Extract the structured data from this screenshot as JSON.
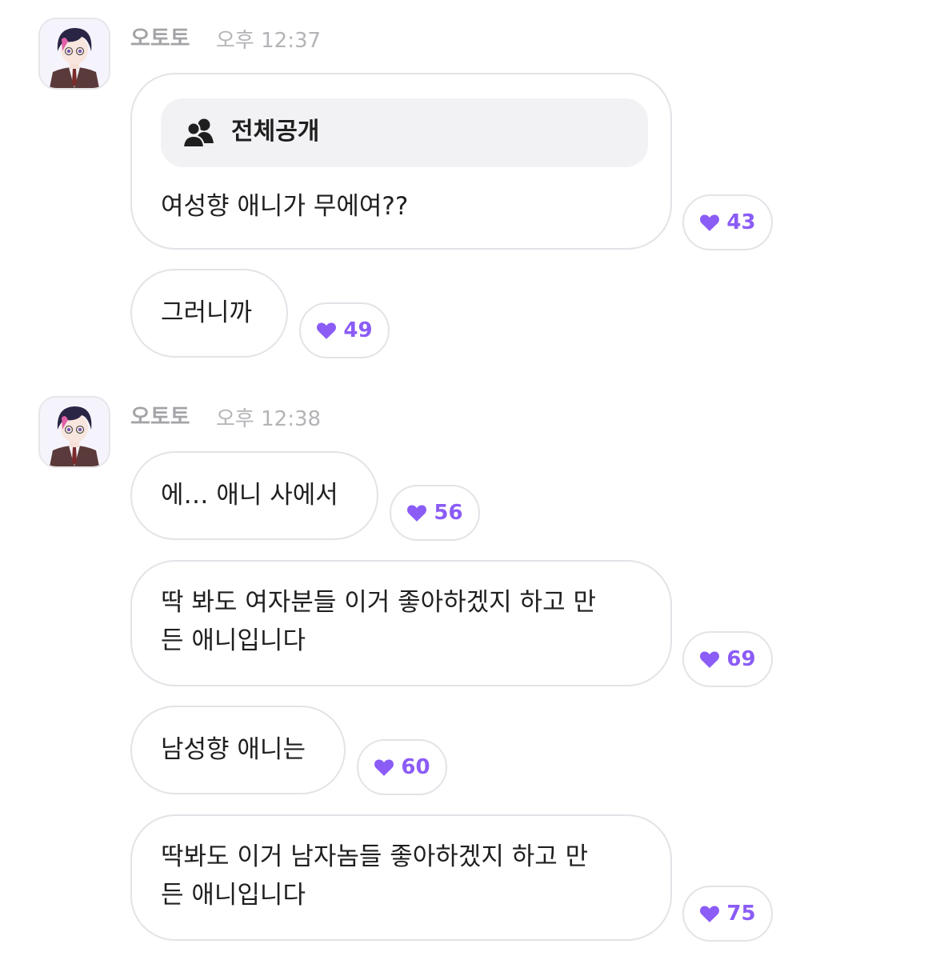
{
  "accent_color": "#8b5cf6",
  "groups": [
    {
      "sender": "오토토",
      "time": "오후 12:37",
      "notice_label": "전체공개",
      "messages": [
        {
          "lines": [
            "여성향 애니가 무에여??"
          ],
          "likes": "43"
        },
        {
          "lines": [
            "그러니까"
          ],
          "likes": "49"
        }
      ]
    },
    {
      "sender": "오토토",
      "time": "오후 12:38",
      "messages": [
        {
          "lines": [
            "에… 애니 사에서"
          ],
          "likes": "56"
        },
        {
          "lines": [
            "딱 봐도 여자분들 이거 좋아하겠지 하고 만",
            "든 애니입니다"
          ],
          "likes": "69"
        },
        {
          "lines": [
            "남성향 애니는"
          ],
          "likes": "60"
        },
        {
          "lines": [
            "딱봐도 이거 남자놈들 좋아하겠지 하고 만",
            "든 애니입니다"
          ],
          "likes": "75"
        }
      ]
    }
  ],
  "icons": {
    "avatar": "anime-character-avatar",
    "notice": "people-icon",
    "like": "heart-icon"
  }
}
